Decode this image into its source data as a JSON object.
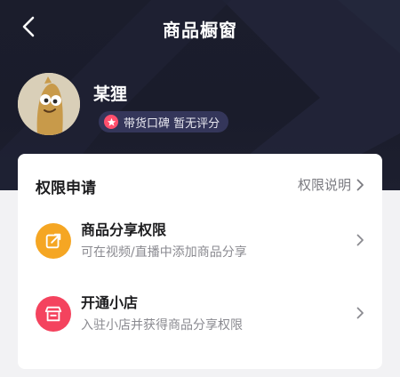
{
  "header": {
    "title": "商品橱窗"
  },
  "profile": {
    "username": "某狸",
    "badge_label": "带货口碑 暂无评分"
  },
  "permissions": {
    "section_title": "权限申请",
    "note_link": "权限说明",
    "items": [
      {
        "title": "商品分享权限",
        "subtitle": "可在视频/直播中添加商品分享",
        "icon": "share-box-icon",
        "color": "#f5a623"
      },
      {
        "title": "开通小店",
        "subtitle": "入驻小店并获得商品分享权限",
        "icon": "shop-icon",
        "color": "#f4435e"
      }
    ]
  }
}
